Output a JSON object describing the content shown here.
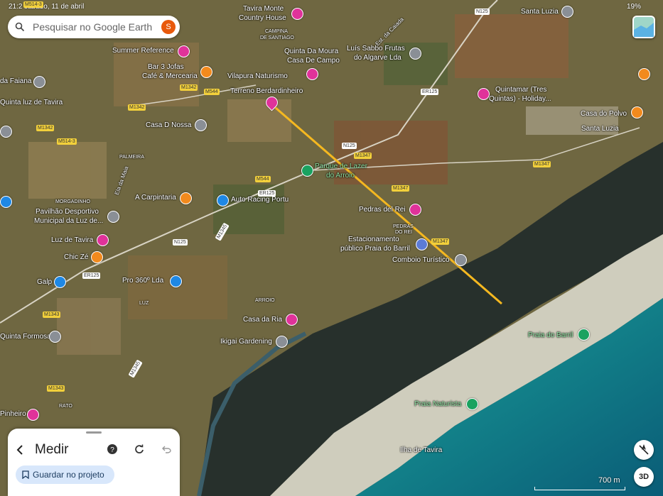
{
  "status_bar": {
    "time": "21:2",
    "date": "sábado, 11 de abril",
    "battery": "19%"
  },
  "search": {
    "placeholder": "Pesquisar no Google Earth",
    "avatar_initial": "S"
  },
  "place_labels": [
    {
      "id": "tavira-monte",
      "text": "Tavira Monte"
    },
    {
      "id": "country-house",
      "text": "Country House"
    },
    {
      "id": "summer-reference",
      "text": "Summer Reference"
    },
    {
      "id": "bar-3-jofas",
      "text": "Bar 3 Jofas"
    },
    {
      "id": "cafe-mercearia",
      "text": "Café & Mercearia"
    },
    {
      "id": "quinta-da-moura",
      "text": "Quinta Da Moura"
    },
    {
      "id": "casa-de-campo",
      "text": "Casa De Campo"
    },
    {
      "id": "luis-sabbo",
      "text": "Luís Sabbo Frutas"
    },
    {
      "id": "do-algarve",
      "text": "do Algarve Lda"
    },
    {
      "id": "santa-luzia-top",
      "text": "Santa Luzia"
    },
    {
      "id": "vilapura",
      "text": "Vilapura Naturismo"
    },
    {
      "id": "terreno",
      "text": "Terreno Berdardinheiro"
    },
    {
      "id": "faiana",
      "text": "da Faiana"
    },
    {
      "id": "quinta-luz",
      "text": "Quinta luz de Tavira"
    },
    {
      "id": "quintamar",
      "text": "Quintamar (Tres"
    },
    {
      "id": "quintamar2",
      "text": "Quintas) - Holiday..."
    },
    {
      "id": "casa-polvo",
      "text": "Casa do Polvo"
    },
    {
      "id": "santa-luzia",
      "text": "Santa Luzia"
    },
    {
      "id": "casa-d-nossa",
      "text": "Casa D Nossa"
    },
    {
      "id": "parque-lazer",
      "text": "Parque de Lazer"
    },
    {
      "id": "do-arroio",
      "text": "do Arroio"
    },
    {
      "id": "a-carpintaria",
      "text": "A Carpintaria"
    },
    {
      "id": "auto-racing",
      "text": "Auto Racing Portu"
    },
    {
      "id": "pedras-del-rei",
      "text": "Pedras del Rei"
    },
    {
      "id": "pavilhao",
      "text": "Pavilhão Desportivo"
    },
    {
      "id": "municipal",
      "text": "Municipal da Luz de..."
    },
    {
      "id": "estacionamento",
      "text": "Estacionamento"
    },
    {
      "id": "publico-barril",
      "text": "público Praia do Barril"
    },
    {
      "id": "comboio",
      "text": "Comboio Turístico"
    },
    {
      "id": "luz-tavira",
      "text": "Luz de Tavira"
    },
    {
      "id": "chic-ze",
      "text": "Chic Zé"
    },
    {
      "id": "galp",
      "text": "Galp"
    },
    {
      "id": "pro-360",
      "text": "Pro 360º Lda"
    },
    {
      "id": "casa-da-ria",
      "text": "Casa da Ria"
    },
    {
      "id": "quinta-formosa",
      "text": "Quinta Formosa"
    },
    {
      "id": "ikigai",
      "text": "Ikigai Gardening"
    },
    {
      "id": "praia-barril",
      "text": "Praia do Barril"
    },
    {
      "id": "praia-naturista",
      "text": "Praia Naturista"
    },
    {
      "id": "pinheiro",
      "text": "Pinheiro"
    },
    {
      "id": "ilha-tavira",
      "text": "Ilha de Tavira"
    },
    {
      "id": "morgadinho",
      "text": "MORGADINHO"
    },
    {
      "id": "rato",
      "text": "RATO"
    },
    {
      "id": "arroio",
      "text": "ARROIO"
    },
    {
      "id": "luz",
      "text": "LUZ"
    },
    {
      "id": "palmeira",
      "text": "PALMEIRA"
    },
    {
      "id": "campina",
      "text": "CAMPINA"
    },
    {
      "id": "de-santiago",
      "text": "DE SANTIAGO"
    },
    {
      "id": "pedras",
      "text": "PEDRAS"
    },
    {
      "id": "do-rei",
      "text": "DO REI"
    },
    {
      "id": "eia-da-maia",
      "text": "Ela da Maia"
    },
    {
      "id": "est-caiada",
      "text": "Est. da Caiada"
    }
  ],
  "road_labels": [
    {
      "id": "m514-3a",
      "text": "M514-3"
    },
    {
      "id": "m514-3b",
      "text": "M514-3"
    },
    {
      "id": "m1342a",
      "text": "M1342"
    },
    {
      "id": "m1342b",
      "text": "M1342"
    },
    {
      "id": "m1342c",
      "text": "M1342"
    },
    {
      "id": "m544a",
      "text": "M544"
    },
    {
      "id": "m544b",
      "text": "M544"
    },
    {
      "id": "er125a",
      "text": "ER125"
    },
    {
      "id": "er125b",
      "text": "ER125"
    },
    {
      "id": "er125c",
      "text": "ER125"
    },
    {
      "id": "n125a",
      "text": "N125"
    },
    {
      "id": "n125b",
      "text": "N125"
    },
    {
      "id": "n125c",
      "text": "N125"
    },
    {
      "id": "m1347a",
      "text": "M1347"
    },
    {
      "id": "m1347b",
      "text": "M1347"
    },
    {
      "id": "m1347c",
      "text": "M1347"
    },
    {
      "id": "m1347d",
      "text": "M1347"
    },
    {
      "id": "m1343a",
      "text": "M1343"
    },
    {
      "id": "m1343b",
      "text": "M1343"
    },
    {
      "id": "m1345a",
      "text": "M1345"
    },
    {
      "id": "m1345b",
      "text": "M1345"
    }
  ],
  "measure_panel": {
    "title": "Medir",
    "save_label": "Guardar no projeto"
  },
  "controls": {
    "mode_3d": "3D"
  },
  "scale": {
    "label": "700 m"
  },
  "colors": {
    "measure_line": "#f5b820",
    "pin_pink": "#e0329a",
    "pin_orange": "#f28a1d",
    "pin_blue": "#1e88e5",
    "pin_green": "#1aa260",
    "sea": "#0f8a86",
    "marsh": "#27302c",
    "sand": "#d5d3c4"
  }
}
